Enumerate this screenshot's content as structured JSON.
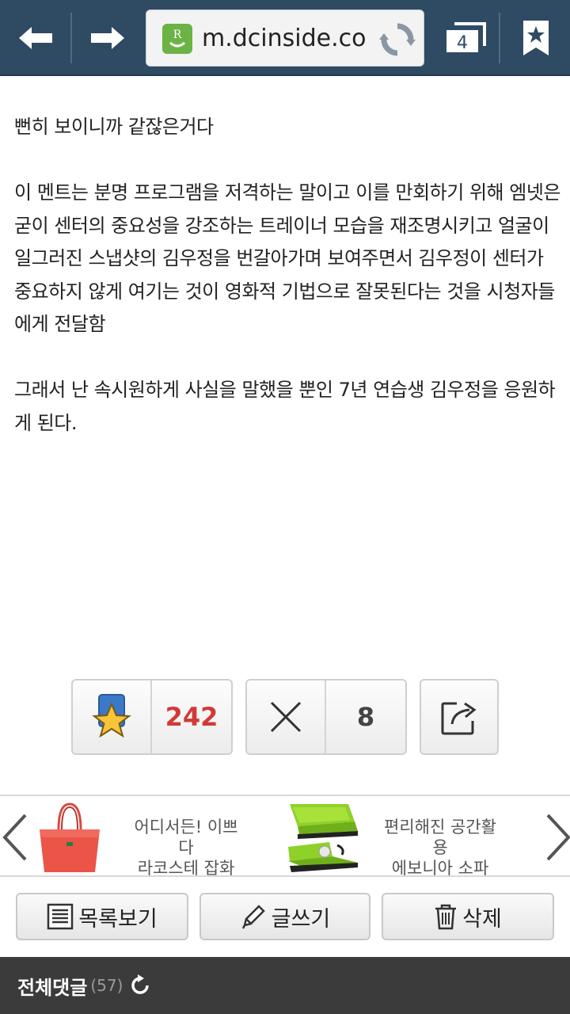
{
  "browser": {
    "url": "m.dcinside.co",
    "tab_count": "4"
  },
  "article": {
    "paragraphs": [
      "뻔히 보이니까 같잖은거다",
      "이 멘트는 분명 프로그램을 저격하는 말이고 이를 만회하기 위해 엠넷은 굳이 센터의 중요성을 강조하는 트레이너 모습을 재조명시키고 얼굴이 일그러진 스냅샷의 김우정을 번갈아가며 보여주면서 김우정이 센터가 중요하지 않게 여기는 것이 영화적 기법으로 잘못된다는 것을 시청자들에게 전달함",
      "그래서 난 속시원하게 사실을 말했을 뿐인 7년 연습생 김우정을 응원하게 된다."
    ]
  },
  "actions": {
    "recommend_count": "242",
    "nonrecommend_count": "8"
  },
  "ad": {
    "item1_line1": "어디서든! 이쁘다",
    "item1_line2": "라코스테 잡화",
    "item2_line1": "편리해진 공간활용",
    "item2_line2": "에보니아 소파"
  },
  "buttons": {
    "list": "목록보기",
    "write": "글쓰기",
    "delete": "삭제"
  },
  "comments": {
    "title": "전체댓글",
    "count": "(57)"
  },
  "colors": {
    "toolbar": "#2f4a63",
    "recommend": "#d23a36",
    "comment_bar": "#3b3b3b"
  }
}
